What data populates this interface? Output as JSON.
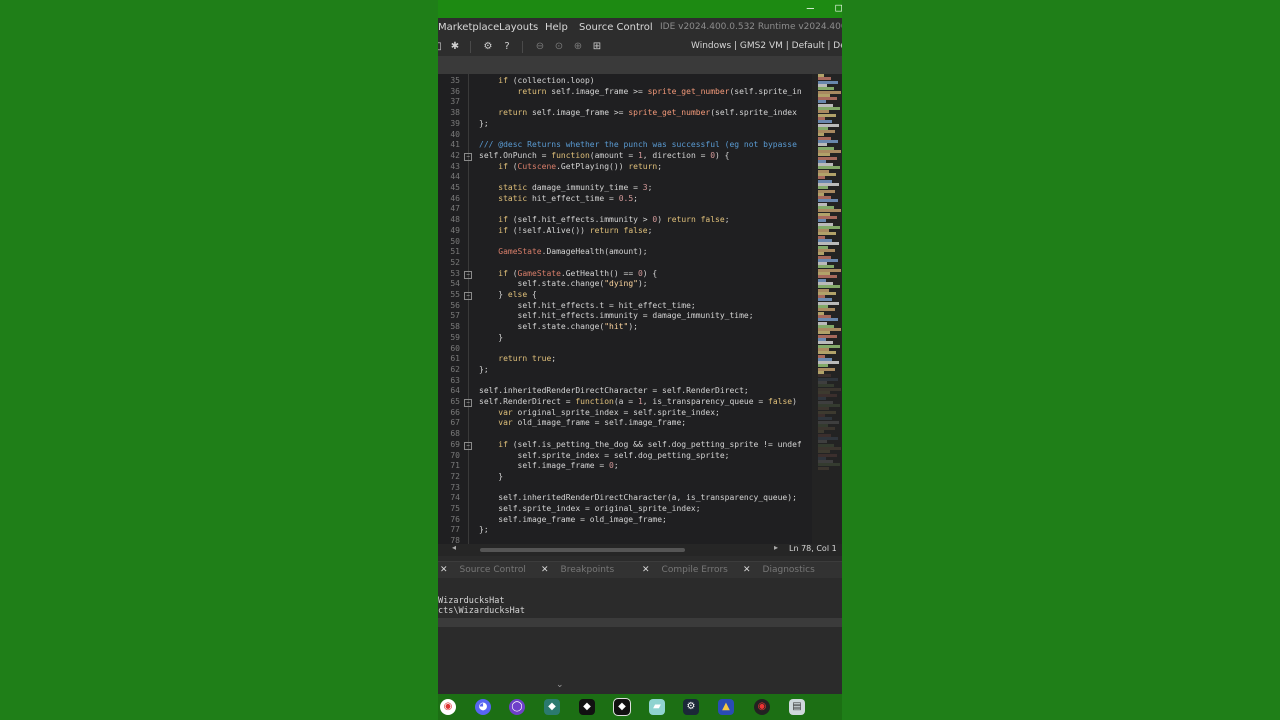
{
  "window": {
    "minimize": "—",
    "maximize": "□"
  },
  "menu": {
    "items": [
      "Marketplace",
      "Layouts",
      "Help",
      "Source Control"
    ],
    "version": "IDE v2024.400.0.532  Runtime v2024.400.0.55"
  },
  "toolbar": {
    "targets": "Windows | GMS2 VM | Default | Def"
  },
  "editor": {
    "lines": [
      {
        "n": "35",
        "t": "    if (collection.loop)"
      },
      {
        "n": "36",
        "t": "        return self.image_frame >= sprite_get_number(self.sprite_in"
      },
      {
        "n": "37",
        "t": ""
      },
      {
        "n": "38",
        "t": "    return self.image_frame >= sprite_get_number(self.sprite_index"
      },
      {
        "n": "39",
        "t": "};"
      },
      {
        "n": "40",
        "t": ""
      },
      {
        "n": "41",
        "t": "/// @desc Returns whether the punch was successful (eg not bypasse"
      },
      {
        "n": "42",
        "t": "self.OnPunch = function(amount = 1, direction = 0) {"
      },
      {
        "n": "43",
        "t": "    if (Cutscene.GetPlaying()) return;"
      },
      {
        "n": "44",
        "t": ""
      },
      {
        "n": "45",
        "t": "    static damage_immunity_time = 3;"
      },
      {
        "n": "46",
        "t": "    static hit_effect_time = 0.5;"
      },
      {
        "n": "47",
        "t": ""
      },
      {
        "n": "48",
        "t": "    if (self.hit_effects.immunity > 0) return false;"
      },
      {
        "n": "49",
        "t": "    if (!self.Alive()) return false;"
      },
      {
        "n": "50",
        "t": ""
      },
      {
        "n": "51",
        "t": "    GameState.DamageHealth(amount);"
      },
      {
        "n": "52",
        "t": ""
      },
      {
        "n": "53",
        "t": "    if (GameState.GetHealth() == 0) {"
      },
      {
        "n": "54",
        "t": "        self.state.change(\"dying\");"
      },
      {
        "n": "55",
        "t": "    } else {"
      },
      {
        "n": "56",
        "t": "        self.hit_effects.t = hit_effect_time;"
      },
      {
        "n": "57",
        "t": "        self.hit_effects.immunity = damage_immunity_time;"
      },
      {
        "n": "58",
        "t": "        self.state.change(\"hit\");"
      },
      {
        "n": "59",
        "t": "    }"
      },
      {
        "n": "60",
        "t": ""
      },
      {
        "n": "61",
        "t": "    return true;"
      },
      {
        "n": "62",
        "t": "};"
      },
      {
        "n": "63",
        "t": ""
      },
      {
        "n": "64",
        "t": "self.inheritedRenderDirectCharacter = self.RenderDirect;"
      },
      {
        "n": "65",
        "t": "self.RenderDirect = function(a = 1, is_transparency_queue = false)"
      },
      {
        "n": "66",
        "t": "    var original_sprite_index = self.sprite_index;"
      },
      {
        "n": "67",
        "t": "    var old_image_frame = self.image_frame;"
      },
      {
        "n": "68",
        "t": ""
      },
      {
        "n": "69",
        "t": "    if (self.is_petting_the_dog && self.dog_petting_sprite != undef"
      },
      {
        "n": "70",
        "t": "        self.sprite_index = self.dog_petting_sprite;"
      },
      {
        "n": "71",
        "t": "        self.image_frame = 0;"
      },
      {
        "n": "72",
        "t": "    }"
      },
      {
        "n": "73",
        "t": ""
      },
      {
        "n": "74",
        "t": "    self.inheritedRenderDirectCharacter(a, is_transparency_queue);"
      },
      {
        "n": "75",
        "t": "    self.sprite_index = original_sprite_index;"
      },
      {
        "n": "76",
        "t": "    self.image_frame = old_image_frame;"
      },
      {
        "n": "77",
        "t": "};"
      },
      {
        "n": "78",
        "t": ""
      }
    ],
    "folds": {
      "42": "⊟",
      "53": "⊟",
      "55": "⊟",
      "65": "⊟",
      "69": "⊟"
    }
  },
  "status": {
    "position": "Ln 78, Col 1",
    "left_arrow": "◂",
    "right_arrow": "▸"
  },
  "output_tabs": [
    "Source Control",
    "Breakpoints",
    "Compile Errors",
    "Diagnostics"
  ],
  "output": {
    "lines": [
      "WizarducksHat",
      "cts\\WizarducksHat"
    ]
  },
  "colors": {
    "keyword": "#e0c07a",
    "comment": "#5a9bd3",
    "string": "#ffd7a0",
    "number": "#d49a9a",
    "builtin": "#f49a7a",
    "global": "#d87e6a",
    "field": "#ffffff"
  },
  "taskbar": {
    "icons": [
      "chrome-icon",
      "discord-icon",
      "github-icon",
      "gamemaker-icon",
      "gamemaker-icon",
      "gamemaker-icon",
      "files-icon",
      "steam-icon",
      "app-icon",
      "chrome-dev-icon",
      "terminal-icon"
    ]
  }
}
